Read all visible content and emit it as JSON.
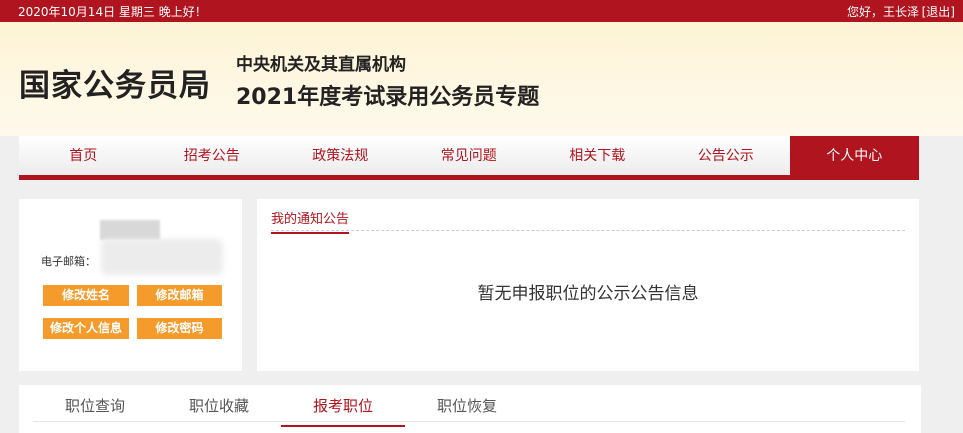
{
  "topbar": {
    "date": "2020年10月14日  星期三  晚上好！",
    "greeting": "您好，王长泽",
    "logout": "[退出]"
  },
  "header": {
    "logo": "国家公务员局",
    "subtitle_line1": "中央机关及其直属机构",
    "subtitle_line2": "2021年度考试录用公务员专题"
  },
  "nav": {
    "items": [
      "首页",
      "招考公告",
      "政策法规",
      "常见问题",
      "相关下载",
      "公告公示",
      "个人中心"
    ],
    "active": "个人中心"
  },
  "profile": {
    "email_label": "电子邮箱：",
    "buttons": {
      "edit_name": "修改姓名",
      "edit_email": "修改邮箱",
      "edit_info": "修改个人信息",
      "edit_password": "修改密码"
    }
  },
  "notice": {
    "title": "我的通知公告",
    "empty_text": "暂无申报职位的公示公告信息"
  },
  "tabs": {
    "items": [
      "职位查询",
      "职位收藏",
      "报考职位",
      "职位恢复"
    ],
    "active": "报考职位"
  },
  "colors": {
    "brand_red": "#b0141e",
    "button_orange": "#f49b2b"
  }
}
